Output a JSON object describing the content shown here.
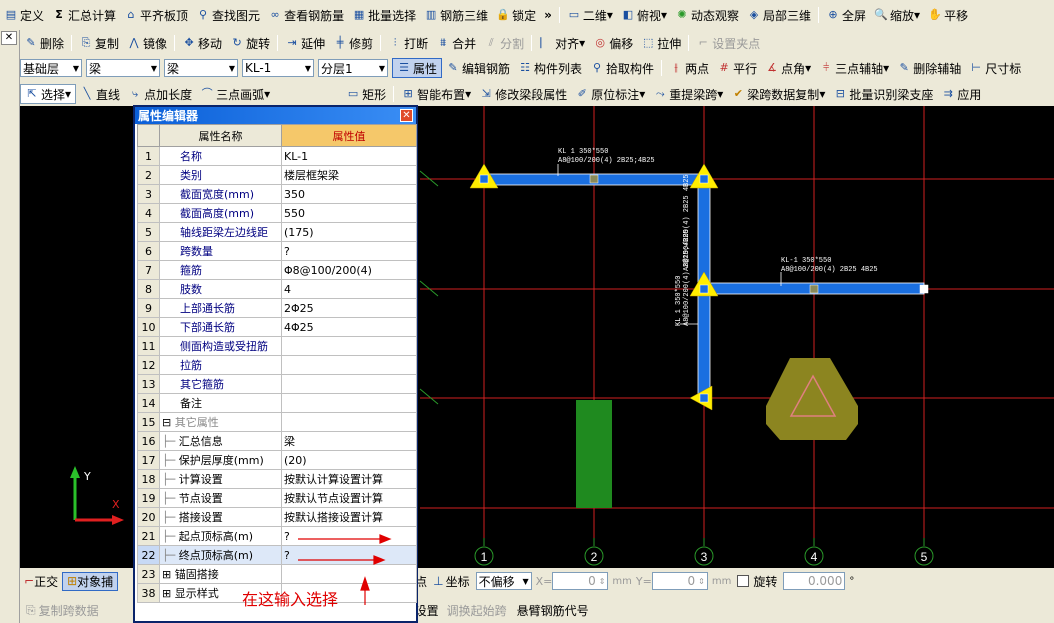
{
  "toolbar1": [
    "定义",
    "汇总计算",
    "平齐板顶",
    "查找图元",
    "查看钢筋量",
    "批量选择",
    "钢筋三维",
    "锁定",
    "二维",
    "俯视",
    "动态观察",
    "局部三维",
    "全屏",
    "缩放",
    "平移"
  ],
  "toolbar2": [
    "删除",
    "复制",
    "镜像",
    "移动",
    "旋转",
    "延伸",
    "修剪",
    "打断",
    "合并",
    "分割",
    "对齐",
    "偏移",
    "拉伸",
    "设置夹点"
  ],
  "toolbar3": {
    "floor": "基础层",
    "cat1": "梁",
    "cat2": "梁",
    "comp": "KL-1",
    "layer": "分层1",
    "buttons": [
      "属性",
      "编辑钢筋",
      "构件列表",
      "拾取构件",
      "两点",
      "平行",
      "点角",
      "三点辅轴",
      "删除辅轴",
      "尺寸标"
    ]
  },
  "toolbar4": [
    "选择",
    "直线",
    "点加长度",
    "三点画弧",
    "矩形",
    "智能布置",
    "修改梁段属性",
    "原位标注",
    "重提梁跨",
    "梁跨数据复制",
    "批量识别梁支座",
    "应用"
  ],
  "editor": {
    "title": "属性编辑器",
    "col_name": "属性名称",
    "col_value": "属性值",
    "rows": [
      {
        "n": "1",
        "name": "名称",
        "value": "KL-1"
      },
      {
        "n": "2",
        "name": "类别",
        "value": "楼层框架梁"
      },
      {
        "n": "3",
        "name": "截面宽度(mm)",
        "value": "350"
      },
      {
        "n": "4",
        "name": "截面高度(mm)",
        "value": "550"
      },
      {
        "n": "5",
        "name": "轴线距梁左边线距",
        "value": "(175)"
      },
      {
        "n": "6",
        "name": "跨数量",
        "value": "?"
      },
      {
        "n": "7",
        "name": "箍筋",
        "value": "Φ8@100/200(4)"
      },
      {
        "n": "8",
        "name": "肢数",
        "value": "4"
      },
      {
        "n": "9",
        "name": "上部通长筋",
        "value": "2Φ25"
      },
      {
        "n": "10",
        "name": "下部通长筋",
        "value": "4Φ25"
      },
      {
        "n": "11",
        "name": "侧面构造或受扭筋",
        "value": ""
      },
      {
        "n": "12",
        "name": "拉筋",
        "value": ""
      },
      {
        "n": "13",
        "name": "其它箍筋",
        "value": ""
      },
      {
        "n": "14",
        "name": "备注",
        "value": ""
      },
      {
        "n": "15",
        "name": "其它属性",
        "value": ""
      },
      {
        "n": "16",
        "name": "汇总信息",
        "value": "梁"
      },
      {
        "n": "17",
        "name": "保护层厚度(mm)",
        "value": "(20)"
      },
      {
        "n": "18",
        "name": "计算设置",
        "value": "按默认计算设置计算"
      },
      {
        "n": "19",
        "name": "节点设置",
        "value": "按默认节点设置计算"
      },
      {
        "n": "20",
        "name": "搭接设置",
        "value": "按默认搭接设置计算"
      },
      {
        "n": "21",
        "name": "起点顶标高(m)",
        "value": "?"
      },
      {
        "n": "22",
        "name": "终点顶标高(m)",
        "value": "?"
      },
      {
        "n": "23",
        "name": "锚固搭接",
        "value": ""
      },
      {
        "n": "38",
        "name": "显示样式",
        "value": ""
      }
    ],
    "note": "在这输入选择"
  },
  "canvas": {
    "axis_labels": [
      "1",
      "2",
      "3",
      "4",
      "5"
    ],
    "beam_label1a": "KL 1 350*550",
    "beam_label1b": "A8@100/200(4) 2B25;4B25",
    "beam_label2a": "KL-1 350*550",
    "beam_label2b": "A8@100/200(4) 2B25 4B25",
    "vlabel_a": "A8@100/200(4) 2B25 4B25",
    "vlabel_b": "KL 1 350*550",
    "vlabel_c": "A8@100/200(4) 2B25;4B25",
    "axis_y": "Y",
    "axis_x": "X"
  },
  "bottombar": {
    "ortho": "正交",
    "snap": "对象捕",
    "endpoint": "顶点",
    "coord": "坐标",
    "offset": "不偏移",
    "x_label": "X=",
    "x_val": "0",
    "y_label": "Y=",
    "y_val": "0",
    "unit": "mm",
    "rotate": "旋转",
    "rot_val": "0.000",
    "deg": "°"
  },
  "status": [
    "复制跨数据",
    "设置",
    "调换起始跨",
    "悬臂钢筋代号"
  ],
  "colors": {
    "beam": "#1a6fe0",
    "grid_red": "#d02020",
    "grid_green": "#2a9a2a",
    "column": "#1f8a1f",
    "accent": "#e00000"
  }
}
